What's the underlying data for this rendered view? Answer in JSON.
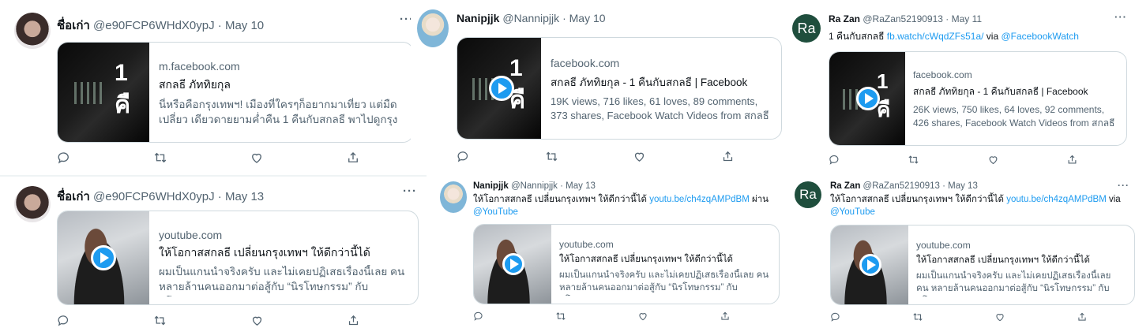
{
  "tweets": [
    {
      "avatar": "girl",
      "name": "ชื่อเก่า",
      "handle": "@e90FCP6WHdX0ypJ",
      "date": "· May 10",
      "more": "···",
      "card": {
        "domain": "m.facebook.com",
        "title": "สกลธี ภัททิยกุล",
        "desc": "นี่หรือคือกรุงเทพฯ! เมืองที่ใครๆก็อยากมาเที่ยว แต่มืด เปลี่ยว เดียวดายยามค่ำคืน 1 คืนกับสกลธี พาไปดูกรุงเท...",
        "thumb": "facebook-video",
        "thumb_text": "1 คื",
        "play": false
      },
      "actions": [
        "reply-icon",
        "retweet-icon",
        "like-icon",
        "share-icon"
      ]
    },
    {
      "avatar": "elsa",
      "name": "Nanipjjk",
      "handle": "@Nannipjjk",
      "date": "· May 10",
      "more": "···",
      "card": {
        "domain": "facebook.com",
        "title": "สกลธี ภัททิยกุล - 1 คืนกับสกลธี | Facebook",
        "desc": "19K views, 716 likes, 61 loves, 89 comments, 373 shares, Facebook Watch Videos from สกลธี ภัททิ...",
        "thumb": "facebook-video",
        "thumb_text": "1 คื",
        "play": true
      },
      "actions": [
        "reply-icon",
        "retweet-icon",
        "like-icon",
        "share-icon"
      ]
    },
    {
      "avatar": "ra",
      "avatar_text": "Ra",
      "name": "Ra Zan",
      "handle": "@RaZan52190913",
      "date": "· May 11",
      "more": "···",
      "text_prefix": "1 คืนกับสกลธี",
      "text_link": "fb.watch/cWqdZFs51a/",
      "text_mid": "via",
      "text_link2": "@FacebookWatch",
      "card": {
        "domain": "facebook.com",
        "title": "สกลธี ภัททิยกุล - 1 คืนกับสกลธี | Facebook",
        "desc": "26K views, 750 likes, 64 loves, 92 comments, 426 shares, Facebook Watch Videos from สกลธี ภัททิ...",
        "thumb": "facebook-video",
        "thumb_text": "1 คื",
        "play": true
      },
      "actions": [
        "reply-icon",
        "retweet-icon",
        "like-icon",
        "share-icon"
      ]
    },
    {
      "avatar": "girl",
      "name": "ชื่อเก่า",
      "handle": "@e90FCP6WHdX0ypJ",
      "date": "· May 13",
      "more": "···",
      "card": {
        "domain": "youtube.com",
        "title": "ให้โอกาสสกลธี เปลี่ยนกรุงเทพฯ ให้ดีกว่านี้ได้",
        "desc": "ผมเป็นแกนนำจริงครับ และไม่เคยปฏิเสธเรื่องนี้เลย คน หลายล้านคนออกมาต่อสู้กับ “นิรโทษกรรม” กับนโยบาย...",
        "thumb": "youtube-video",
        "play": true
      },
      "actions": [
        "reply-icon",
        "retweet-icon",
        "like-icon",
        "share-icon"
      ]
    },
    {
      "avatar": "elsa",
      "name": "Nanipjjk",
      "handle": "@Nannipjjk",
      "date": "· May 13",
      "more": "···",
      "text_prefix": "ให้โอกาสสกลธี เปลี่ยนกรุงเทพฯ ให้ดีกว่านี้ได้",
      "text_link": "youtu.be/ch4zqAMPdBM",
      "text_mid": "ผ่าน",
      "text_link2": "@YouTube",
      "card": {
        "domain": "youtube.com",
        "title": "ให้โอกาสสกลธี เปลี่ยนกรุงเทพฯ ให้ดีกว่านี้ได้",
        "desc": "ผมเป็นแกนนำจริงครับ และไม่เคยปฏิเสธเรื่องนี้เลย คน หลายล้านคนออกมาต่อสู้กับ “นิรโทษกรรม” กับนโยบาย...",
        "thumb": "youtube-video",
        "play": true
      },
      "actions": [
        "reply-icon",
        "retweet-icon",
        "like-icon",
        "share-icon"
      ]
    },
    {
      "avatar": "ra",
      "avatar_text": "Ra",
      "name": "Ra Zan",
      "handle": "@RaZan52190913",
      "date": "· May 13",
      "more": "···",
      "text_prefix": "ให้โอกาสสกลธี เปลี่ยนกรุงเทพฯ ให้ดีกว่านี้ได้",
      "text_link": "youtu.be/ch4zqAMPdBM",
      "text_mid": "via",
      "text_link2": "@YouTube",
      "card": {
        "domain": "youtube.com",
        "title": "ให้โอกาสสกลธี เปลี่ยนกรุงเทพฯ ให้ดีกว่านี้ได้",
        "desc": "ผมเป็นแกนนำจริงครับ และไม่เคยปฏิเสธเรื่องนี้เลย คน หลายล้านคนออกมาต่อสู้กับ “นิรโทษกรรม” กับนโยบาย...",
        "thumb": "youtube-video",
        "play": true
      },
      "actions": [
        "reply-icon",
        "retweet-icon",
        "like-icon",
        "share-icon"
      ]
    }
  ]
}
